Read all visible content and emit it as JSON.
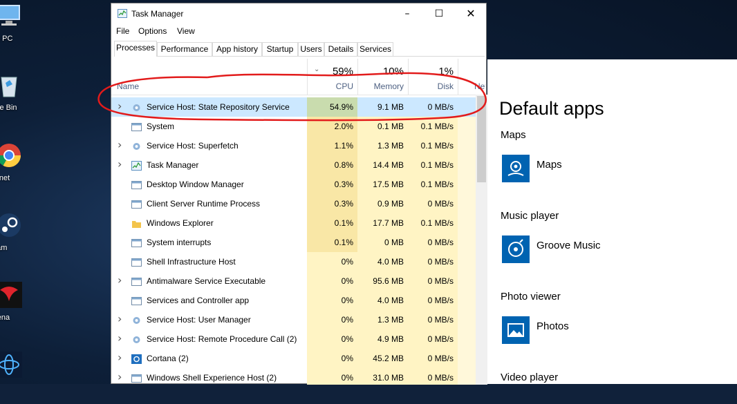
{
  "desktop": {
    "icons": [
      {
        "label": "his PC",
        "icon": "monitor-icon"
      },
      {
        "label": "ycle Bin",
        "icon": "recycle-bin-icon"
      },
      {
        "label": "ternet",
        "icon": "chrome-icon"
      },
      {
        "label": "team",
        "icon": "steam-icon"
      },
      {
        "label": "arena",
        "icon": "garena-icon"
      },
      {
        "label": "",
        "icon": "battlenet-icon"
      }
    ]
  },
  "settings": {
    "title": "Default apps",
    "sections": [
      {
        "heading": "Maps",
        "app": "Maps",
        "icon": "maps-icon"
      },
      {
        "heading": "Music player",
        "app": "Groove Music",
        "icon": "groove-icon"
      },
      {
        "heading": "Photo viewer",
        "app": "Photos",
        "icon": "photos-icon"
      },
      {
        "heading": "Video player",
        "app": "",
        "icon": ""
      }
    ]
  },
  "taskmanager": {
    "title": "Task Manager",
    "menu": [
      "File",
      "Options",
      "View"
    ],
    "tabs": [
      "Processes",
      "Performance",
      "App history",
      "Startup",
      "Users",
      "Details",
      "Services"
    ],
    "active_tab": "Processes",
    "header": {
      "name": "Name",
      "cpu_pct": "59%",
      "cpu": "CPU",
      "mem_pct": "10%",
      "mem": "Memory",
      "disk_pct": "1%",
      "disk": "Disk",
      "net": "Net"
    },
    "rows": [
      {
        "name": "Service Host: State Repository Service",
        "cpu": "54.9%",
        "mem": "9.1 MB",
        "disk": "0 MB/s",
        "expand": true,
        "icon": "gear-icon",
        "selected": true
      },
      {
        "name": "System",
        "cpu": "2.0%",
        "mem": "0.1 MB",
        "disk": "0.1 MB/s",
        "expand": false,
        "icon": "window-icon"
      },
      {
        "name": "Service Host: Superfetch",
        "cpu": "1.1%",
        "mem": "1.3 MB",
        "disk": "0.1 MB/s",
        "expand": true,
        "icon": "gear-icon"
      },
      {
        "name": "Task Manager",
        "cpu": "0.8%",
        "mem": "14.4 MB",
        "disk": "0.1 MB/s",
        "expand": true,
        "icon": "taskmgr-icon"
      },
      {
        "name": "Desktop Window Manager",
        "cpu": "0.3%",
        "mem": "17.5 MB",
        "disk": "0.1 MB/s",
        "expand": false,
        "icon": "window-icon"
      },
      {
        "name": "Client Server Runtime Process",
        "cpu": "0.3%",
        "mem": "0.9 MB",
        "disk": "0 MB/s",
        "expand": false,
        "icon": "window-icon"
      },
      {
        "name": "Windows Explorer",
        "cpu": "0.1%",
        "mem": "17.7 MB",
        "disk": "0.1 MB/s",
        "expand": false,
        "icon": "folder-icon"
      },
      {
        "name": "System interrupts",
        "cpu": "0.1%",
        "mem": "0 MB",
        "disk": "0 MB/s",
        "expand": false,
        "icon": "window-icon"
      },
      {
        "name": "Shell Infrastructure Host",
        "cpu": "0%",
        "mem": "4.0 MB",
        "disk": "0 MB/s",
        "expand": false,
        "icon": "window-icon"
      },
      {
        "name": "Antimalware Service Executable",
        "cpu": "0%",
        "mem": "95.6 MB",
        "disk": "0 MB/s",
        "expand": true,
        "icon": "window-icon"
      },
      {
        "name": "Services and Controller app",
        "cpu": "0%",
        "mem": "4.0 MB",
        "disk": "0 MB/s",
        "expand": false,
        "icon": "window-icon"
      },
      {
        "name": "Service Host: User Manager",
        "cpu": "0%",
        "mem": "1.3 MB",
        "disk": "0 MB/s",
        "expand": true,
        "icon": "gear-icon"
      },
      {
        "name": "Service Host: Remote Procedure Call (2)",
        "cpu": "0%",
        "mem": "4.9 MB",
        "disk": "0 MB/s",
        "expand": true,
        "icon": "gear-icon"
      },
      {
        "name": "Cortana (2)",
        "cpu": "0%",
        "mem": "45.2 MB",
        "disk": "0 MB/s",
        "expand": true,
        "icon": "cortana-icon"
      },
      {
        "name": "Windows Shell Experience Host (2)",
        "cpu": "0%",
        "mem": "31.0 MB",
        "disk": "0 MB/s",
        "expand": true,
        "icon": "window-icon"
      }
    ]
  },
  "colors": {
    "cpu_hot": "#f9e7a6",
    "cell_light": "#fff4c4",
    "cell_lighter": "#fff8da",
    "selection": "#cce8ff",
    "annotation": "#e21b1b",
    "accent": "#0063b1"
  }
}
